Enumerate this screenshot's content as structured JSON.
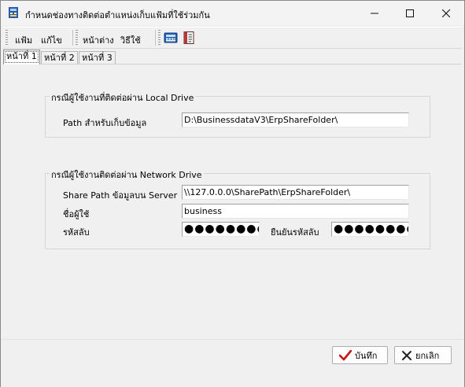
{
  "window": {
    "title": "กำหนดช่องทางติดต่อตำแหน่งเก็บแฟ้มที่ใช้ร่วมกัน",
    "minimize_icon": "minimize-icon",
    "maximize_icon": "maximize-icon",
    "close_icon": "close-icon"
  },
  "menu": {
    "items": [
      "แฟ้ม",
      "แก้ไข",
      "หน้าต่าง",
      "วิธีใช้"
    ],
    "toolbar_icons": [
      "calculator-icon",
      "document-icon"
    ]
  },
  "tabs": [
    "หน้าที่ 1",
    "หน้าที่ 2",
    "หน้าที่ 3"
  ],
  "local_group": {
    "title": "กรณีผู้ใช้งานที่ติดต่อผ่าน Local Drive",
    "path_label": "Path สำหรับเก็บข้อมูล",
    "path_value": "D:\\BusinessdataV3\\ErpShareFolder\\"
  },
  "network_group": {
    "title": "กรณีผู้ใช้งานติดต่อผ่าน Network Drive",
    "share_path_label": "Share Path ข้อมูลบน Server",
    "share_path_value": "\\\\127.0.0.0\\SharePath\\ErpShareFolder\\",
    "user_label": "ชื่อผู้ใช้",
    "user_value": "business",
    "password_label": "รหัสลับ",
    "password_value": "●●●●●●●●",
    "confirm_label": "ยืนยันรหัสลับ",
    "confirm_value": "●●●●●●●●"
  },
  "buttons": {
    "save": "บันทึก",
    "cancel": "ยกเลิก"
  },
  "colors": {
    "save_check": "#cc1111",
    "cancel_x": "#222222"
  }
}
